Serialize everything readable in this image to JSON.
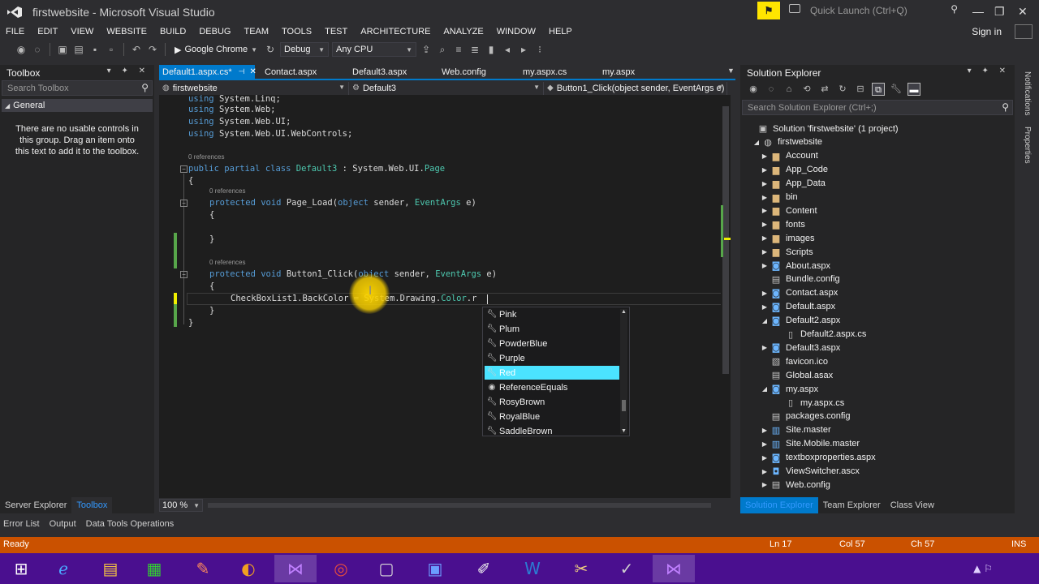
{
  "window": {
    "title": "firstwebsite - Microsoft Visual Studio",
    "quick_launch_placeholder": "Quick Launch (Ctrl+Q)",
    "sign_in": "Sign in"
  },
  "menu": [
    "FILE",
    "EDIT",
    "VIEW",
    "WEBSITE",
    "BUILD",
    "DEBUG",
    "TEAM",
    "TOOLS",
    "TEST",
    "ARCHITECTURE",
    "ANALYZE",
    "WINDOW",
    "HELP"
  ],
  "toolbar": {
    "run_target": "Google Chrome",
    "configuration": "Debug",
    "platform": "Any CPU"
  },
  "toolbox": {
    "title": "Toolbox",
    "search_placeholder": "Search Toolbox",
    "group": "General",
    "empty_message": "There are no usable controls in this group. Drag an item onto this text to add it to the toolbox.",
    "bottom_tabs": [
      "Server Explorer",
      "Toolbox"
    ]
  },
  "editor": {
    "tabs": [
      {
        "label": "Default1.aspx.cs*",
        "active": true
      },
      {
        "label": "Contact.aspx",
        "active": false
      },
      {
        "label": "Default3.aspx",
        "active": false
      },
      {
        "label": "Web.config",
        "active": false
      },
      {
        "label": "my.aspx.cs",
        "active": false
      },
      {
        "label": "my.aspx",
        "active": false
      }
    ],
    "nav_project": "firstwebsite",
    "nav_class": "Default3",
    "nav_member": "Button1_Click(object sender, EventArgs e)",
    "zoom": "100 %",
    "references_label": "0 references",
    "code": {
      "l1a": "using ",
      "l1b": "System.Linq;",
      "l2a": "using ",
      "l2b": "System.Web;",
      "l3a": "using ",
      "l3b": "System.Web.UI;",
      "l4a": "using ",
      "l4b": "System.Web.UI.WebControls;",
      "l5a": "public partial class ",
      "l5b": "Default3",
      "l5c": " : System.Web.UI.",
      "l5d": "Page",
      "l6": "{",
      "l7a": "protected void ",
      "l7b": "Page_Load(",
      "l7c": "object",
      "l7d": " sender, ",
      "l7e": "EventArgs",
      "l7f": " e)",
      "l8": "{",
      "l9": "}",
      "l10a": "protected void ",
      "l10b": "Button1_Click(",
      "l10c": "object",
      "l10d": " sender, ",
      "l10e": "EventArgs",
      "l10f": " e)",
      "l11": "{",
      "l12a": "CheckBoxList1.BackColor = System.Drawing.",
      "l12b": "Color",
      "l12c": ".r",
      "l13": "}",
      "l14": "}"
    }
  },
  "intellisense": {
    "items": [
      {
        "label": "Pink",
        "icon": "property-icon"
      },
      {
        "label": "Plum",
        "icon": "property-icon"
      },
      {
        "label": "PowderBlue",
        "icon": "property-icon"
      },
      {
        "label": "Purple",
        "icon": "property-icon"
      },
      {
        "label": "Red",
        "icon": "property-icon",
        "selected": true
      },
      {
        "label": "ReferenceEquals",
        "icon": "method-icon"
      },
      {
        "label": "RosyBrown",
        "icon": "property-icon"
      },
      {
        "label": "RoyalBlue",
        "icon": "property-icon"
      },
      {
        "label": "SaddleBrown",
        "icon": "property-icon"
      }
    ]
  },
  "solution_explorer": {
    "title": "Solution Explorer",
    "search_placeholder": "Search Solution Explorer (Ctrl+;)",
    "tree": [
      {
        "label": "Solution 'firstwebsite' (1 project)",
        "icon": "solution-icon",
        "level": 0,
        "exp": ""
      },
      {
        "label": "firstwebsite",
        "icon": "website-icon",
        "level": 1,
        "exp": "open"
      },
      {
        "label": "Account",
        "icon": "folder-icon",
        "level": 2,
        "exp": "closed"
      },
      {
        "label": "App_Code",
        "icon": "folder-icon",
        "level": 2,
        "exp": "closed"
      },
      {
        "label": "App_Data",
        "icon": "folder-icon",
        "level": 2,
        "exp": "closed"
      },
      {
        "label": "bin",
        "icon": "folder-icon",
        "level": 2,
        "exp": "closed"
      },
      {
        "label": "Content",
        "icon": "folder-icon",
        "level": 2,
        "exp": "closed"
      },
      {
        "label": "fonts",
        "icon": "folder-icon",
        "level": 2,
        "exp": "closed"
      },
      {
        "label": "images",
        "icon": "folder-icon",
        "level": 2,
        "exp": "closed"
      },
      {
        "label": "Scripts",
        "icon": "folder-icon",
        "level": 2,
        "exp": "closed"
      },
      {
        "label": "About.aspx",
        "icon": "aspx-icon",
        "level": 2,
        "exp": "closed"
      },
      {
        "label": "Bundle.config",
        "icon": "config-icon",
        "level": 2,
        "exp": ""
      },
      {
        "label": "Contact.aspx",
        "icon": "aspx-icon",
        "level": 2,
        "exp": "closed"
      },
      {
        "label": "Default.aspx",
        "icon": "aspx-icon",
        "level": 2,
        "exp": "closed"
      },
      {
        "label": "Default2.aspx",
        "icon": "aspx-icon",
        "level": 2,
        "exp": "open"
      },
      {
        "label": "Default2.aspx.cs",
        "icon": "cs-icon",
        "level": 3,
        "exp": ""
      },
      {
        "label": "Default3.aspx",
        "icon": "aspx-icon",
        "level": 2,
        "exp": "closed"
      },
      {
        "label": "favicon.ico",
        "icon": "image-icon",
        "level": 2,
        "exp": ""
      },
      {
        "label": "Global.asax",
        "icon": "config-icon",
        "level": 2,
        "exp": ""
      },
      {
        "label": "my.aspx",
        "icon": "aspx-icon",
        "level": 2,
        "exp": "open"
      },
      {
        "label": "my.aspx.cs",
        "icon": "cs-icon",
        "level": 3,
        "exp": ""
      },
      {
        "label": "packages.config",
        "icon": "config-icon",
        "level": 2,
        "exp": ""
      },
      {
        "label": "Site.master",
        "icon": "master-icon",
        "level": 2,
        "exp": "closed"
      },
      {
        "label": "Site.Mobile.master",
        "icon": "master-icon",
        "level": 2,
        "exp": "closed"
      },
      {
        "label": "textboxproperties.aspx",
        "icon": "aspx-icon",
        "level": 2,
        "exp": "closed"
      },
      {
        "label": "ViewSwitcher.ascx",
        "icon": "ascx-icon",
        "level": 2,
        "exp": "closed"
      },
      {
        "label": "Web.config",
        "icon": "config-icon",
        "level": 2,
        "exp": "closed"
      }
    ],
    "bottom_tabs": [
      "Solution Explorer",
      "Team Explorer",
      "Class View"
    ]
  },
  "side_tabs": [
    "Notifications",
    "Properties"
  ],
  "output_tabs": [
    "Error List",
    "Output",
    "Data Tools Operations"
  ],
  "status": {
    "text": "Ready",
    "line": "Ln 17",
    "col": "Col 57",
    "ch": "Ch 57",
    "mode": "INS"
  },
  "colors": {
    "accent": "#007acc",
    "statusbar": "#ca5100",
    "taskbar": "#4a0f8f",
    "selection": "#4be3ff"
  }
}
